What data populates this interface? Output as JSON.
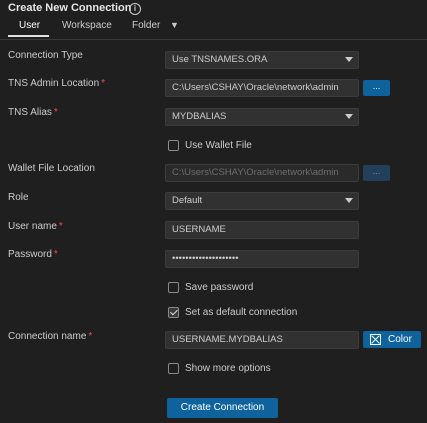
{
  "header": {
    "title": "Create New Connection",
    "info_icon": "info-icon"
  },
  "tabs": [
    {
      "label": "User",
      "active": true
    },
    {
      "label": "Workspace",
      "active": false
    },
    {
      "label": "Folder",
      "active": false
    }
  ],
  "form": {
    "connection_type": {
      "label": "Connection Type",
      "value": "Use TNSNAMES.ORA"
    },
    "tns_admin": {
      "label": "TNS Admin Location",
      "required": "*",
      "value": "C:\\Users\\CSHAY\\Oracle\\network\\admin",
      "browse": "..."
    },
    "tns_alias": {
      "label": "TNS Alias",
      "required": "*",
      "value": "MYDBALIAS"
    },
    "use_wallet": {
      "label": "Use Wallet File",
      "checked": false
    },
    "wallet_location": {
      "label": "Wallet File Location",
      "value": "C:\\Users\\CSHAY\\Oracle\\network\\admin",
      "browse": "..."
    },
    "role": {
      "label": "Role",
      "value": "Default"
    },
    "username": {
      "label": "User name",
      "required": "*",
      "value": "USERNAME"
    },
    "password": {
      "label": "Password",
      "required": "*",
      "value": "••••••••••••••••••••"
    },
    "save_password": {
      "label": "Save password",
      "checked": false
    },
    "default_connection": {
      "label": "Set as default connection",
      "checked": true
    },
    "connection_name": {
      "label": "Connection name",
      "required": "*",
      "value": "USERNAME.MYDBALIAS",
      "color_label": "Color"
    },
    "show_more": {
      "label": "Show more options",
      "checked": false
    }
  },
  "submit_label": "Create Connection",
  "colors": {
    "accent": "#0e639c",
    "background": "#1f1f1f",
    "required": "#f14c4c"
  }
}
